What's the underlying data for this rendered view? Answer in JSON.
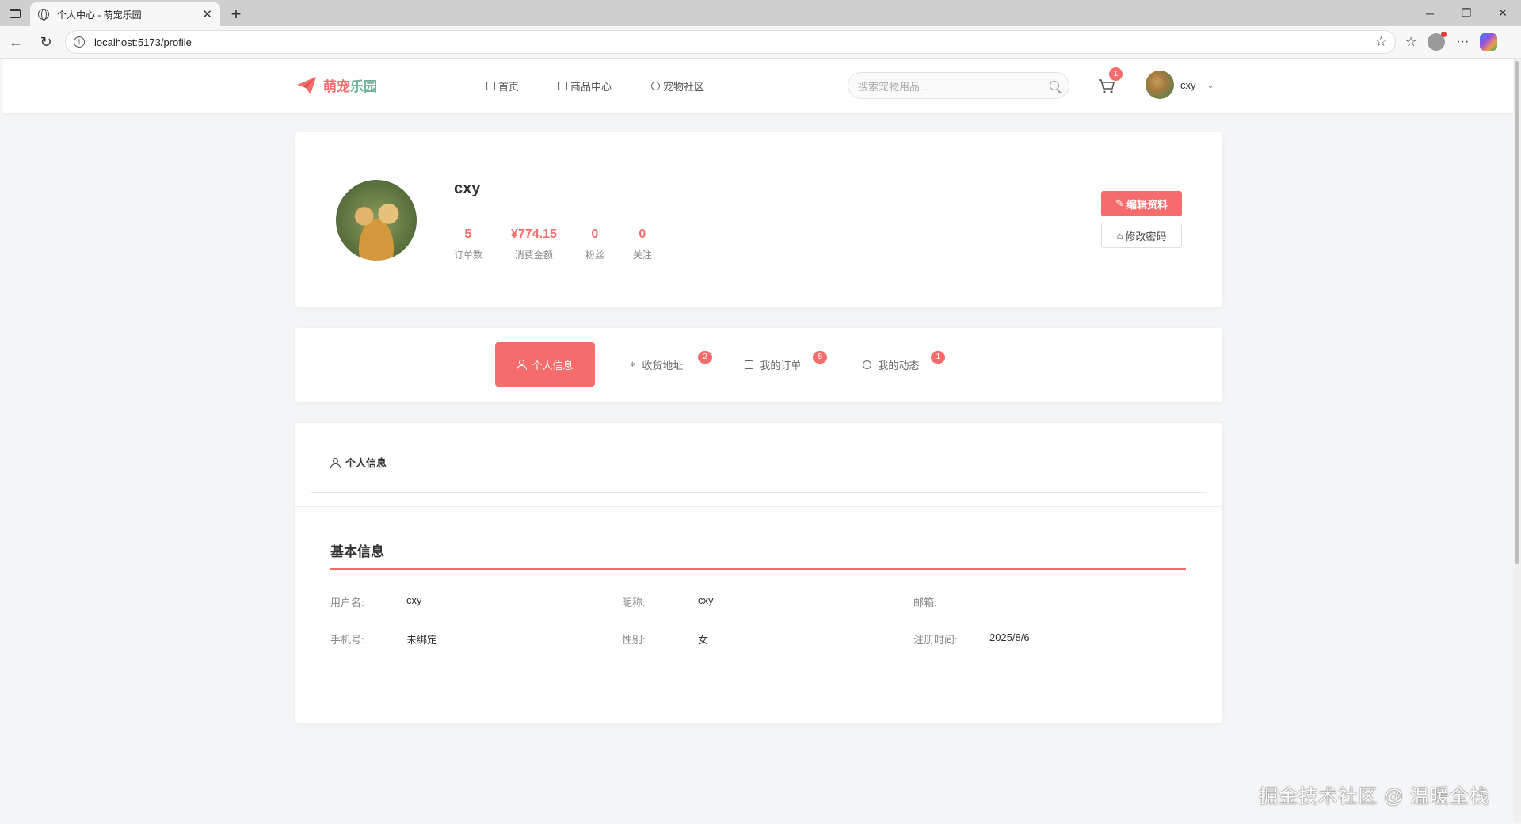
{
  "browser": {
    "tab_title": "个人中心 - 萌宠乐园",
    "url": "localhost:5173/profile"
  },
  "header": {
    "logo_text_a": "萌宠",
    "logo_text_b": "乐园",
    "nav": [
      "首页",
      "商品中心",
      "宠物社区"
    ],
    "search_placeholder": "搜索宠物用品...",
    "cart_count": "1",
    "username": "cxy"
  },
  "profile": {
    "username": "cxy",
    "stats": [
      {
        "value": "5",
        "label": "订单数"
      },
      {
        "value": "¥774.15",
        "label": "消费金额"
      },
      {
        "value": "0",
        "label": "粉丝"
      },
      {
        "value": "0",
        "label": "关注"
      }
    ],
    "edit_button": "编辑资料",
    "password_button": "修改密码"
  },
  "tabs": [
    {
      "label": "个人信息",
      "badge": ""
    },
    {
      "label": "收货地址",
      "badge": "2"
    },
    {
      "label": "我的订单",
      "badge": "5"
    },
    {
      "label": "我的动态",
      "badge": "1"
    }
  ],
  "info": {
    "heading": "个人信息",
    "section_title": "基本信息",
    "fields": [
      {
        "key": "用户名:",
        "value": "cxy"
      },
      {
        "key": "昵称:",
        "value": "cxy"
      },
      {
        "key": "邮箱:",
        "value": ""
      },
      {
        "key": "手机号:",
        "value": "未绑定"
      },
      {
        "key": "性别:",
        "value": "女"
      },
      {
        "key": "注册时间:",
        "value": "2025/8/6"
      }
    ]
  },
  "watermark": "掘金技术社区 @ 温暖全栈",
  "colors": {
    "accent": "#f56c6c",
    "logo_green": "#6ab39a",
    "background": "#f4f5f7"
  }
}
